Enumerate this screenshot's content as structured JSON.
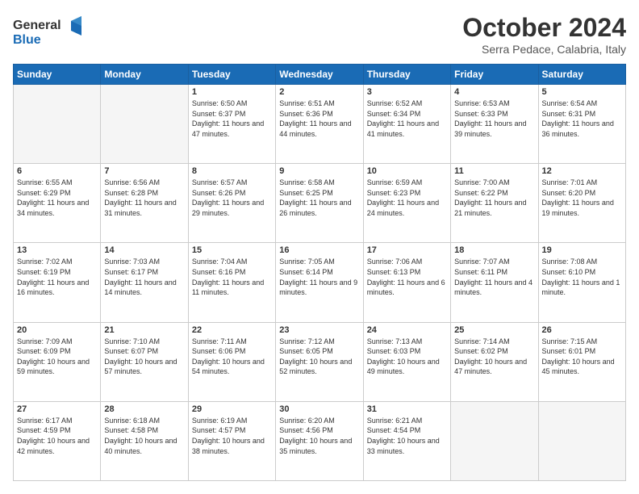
{
  "logo": {
    "line1": "General",
    "line2": "Blue"
  },
  "header": {
    "month": "October 2024",
    "location": "Serra Pedace, Calabria, Italy"
  },
  "weekdays": [
    "Sunday",
    "Monday",
    "Tuesday",
    "Wednesday",
    "Thursday",
    "Friday",
    "Saturday"
  ],
  "weeks": [
    [
      {
        "day": "",
        "info": ""
      },
      {
        "day": "",
        "info": ""
      },
      {
        "day": "1",
        "info": "Sunrise: 6:50 AM\nSunset: 6:37 PM\nDaylight: 11 hours and 47 minutes."
      },
      {
        "day": "2",
        "info": "Sunrise: 6:51 AM\nSunset: 6:36 PM\nDaylight: 11 hours and 44 minutes."
      },
      {
        "day": "3",
        "info": "Sunrise: 6:52 AM\nSunset: 6:34 PM\nDaylight: 11 hours and 41 minutes."
      },
      {
        "day": "4",
        "info": "Sunrise: 6:53 AM\nSunset: 6:33 PM\nDaylight: 11 hours and 39 minutes."
      },
      {
        "day": "5",
        "info": "Sunrise: 6:54 AM\nSunset: 6:31 PM\nDaylight: 11 hours and 36 minutes."
      }
    ],
    [
      {
        "day": "6",
        "info": "Sunrise: 6:55 AM\nSunset: 6:29 PM\nDaylight: 11 hours and 34 minutes."
      },
      {
        "day": "7",
        "info": "Sunrise: 6:56 AM\nSunset: 6:28 PM\nDaylight: 11 hours and 31 minutes."
      },
      {
        "day": "8",
        "info": "Sunrise: 6:57 AM\nSunset: 6:26 PM\nDaylight: 11 hours and 29 minutes."
      },
      {
        "day": "9",
        "info": "Sunrise: 6:58 AM\nSunset: 6:25 PM\nDaylight: 11 hours and 26 minutes."
      },
      {
        "day": "10",
        "info": "Sunrise: 6:59 AM\nSunset: 6:23 PM\nDaylight: 11 hours and 24 minutes."
      },
      {
        "day": "11",
        "info": "Sunrise: 7:00 AM\nSunset: 6:22 PM\nDaylight: 11 hours and 21 minutes."
      },
      {
        "day": "12",
        "info": "Sunrise: 7:01 AM\nSunset: 6:20 PM\nDaylight: 11 hours and 19 minutes."
      }
    ],
    [
      {
        "day": "13",
        "info": "Sunrise: 7:02 AM\nSunset: 6:19 PM\nDaylight: 11 hours and 16 minutes."
      },
      {
        "day": "14",
        "info": "Sunrise: 7:03 AM\nSunset: 6:17 PM\nDaylight: 11 hours and 14 minutes."
      },
      {
        "day": "15",
        "info": "Sunrise: 7:04 AM\nSunset: 6:16 PM\nDaylight: 11 hours and 11 minutes."
      },
      {
        "day": "16",
        "info": "Sunrise: 7:05 AM\nSunset: 6:14 PM\nDaylight: 11 hours and 9 minutes."
      },
      {
        "day": "17",
        "info": "Sunrise: 7:06 AM\nSunset: 6:13 PM\nDaylight: 11 hours and 6 minutes."
      },
      {
        "day": "18",
        "info": "Sunrise: 7:07 AM\nSunset: 6:11 PM\nDaylight: 11 hours and 4 minutes."
      },
      {
        "day": "19",
        "info": "Sunrise: 7:08 AM\nSunset: 6:10 PM\nDaylight: 11 hours and 1 minute."
      }
    ],
    [
      {
        "day": "20",
        "info": "Sunrise: 7:09 AM\nSunset: 6:09 PM\nDaylight: 10 hours and 59 minutes."
      },
      {
        "day": "21",
        "info": "Sunrise: 7:10 AM\nSunset: 6:07 PM\nDaylight: 10 hours and 57 minutes."
      },
      {
        "day": "22",
        "info": "Sunrise: 7:11 AM\nSunset: 6:06 PM\nDaylight: 10 hours and 54 minutes."
      },
      {
        "day": "23",
        "info": "Sunrise: 7:12 AM\nSunset: 6:05 PM\nDaylight: 10 hours and 52 minutes."
      },
      {
        "day": "24",
        "info": "Sunrise: 7:13 AM\nSunset: 6:03 PM\nDaylight: 10 hours and 49 minutes."
      },
      {
        "day": "25",
        "info": "Sunrise: 7:14 AM\nSunset: 6:02 PM\nDaylight: 10 hours and 47 minutes."
      },
      {
        "day": "26",
        "info": "Sunrise: 7:15 AM\nSunset: 6:01 PM\nDaylight: 10 hours and 45 minutes."
      }
    ],
    [
      {
        "day": "27",
        "info": "Sunrise: 6:17 AM\nSunset: 4:59 PM\nDaylight: 10 hours and 42 minutes."
      },
      {
        "day": "28",
        "info": "Sunrise: 6:18 AM\nSunset: 4:58 PM\nDaylight: 10 hours and 40 minutes."
      },
      {
        "day": "29",
        "info": "Sunrise: 6:19 AM\nSunset: 4:57 PM\nDaylight: 10 hours and 38 minutes."
      },
      {
        "day": "30",
        "info": "Sunrise: 6:20 AM\nSunset: 4:56 PM\nDaylight: 10 hours and 35 minutes."
      },
      {
        "day": "31",
        "info": "Sunrise: 6:21 AM\nSunset: 4:54 PM\nDaylight: 10 hours and 33 minutes."
      },
      {
        "day": "",
        "info": ""
      },
      {
        "day": "",
        "info": ""
      }
    ]
  ]
}
